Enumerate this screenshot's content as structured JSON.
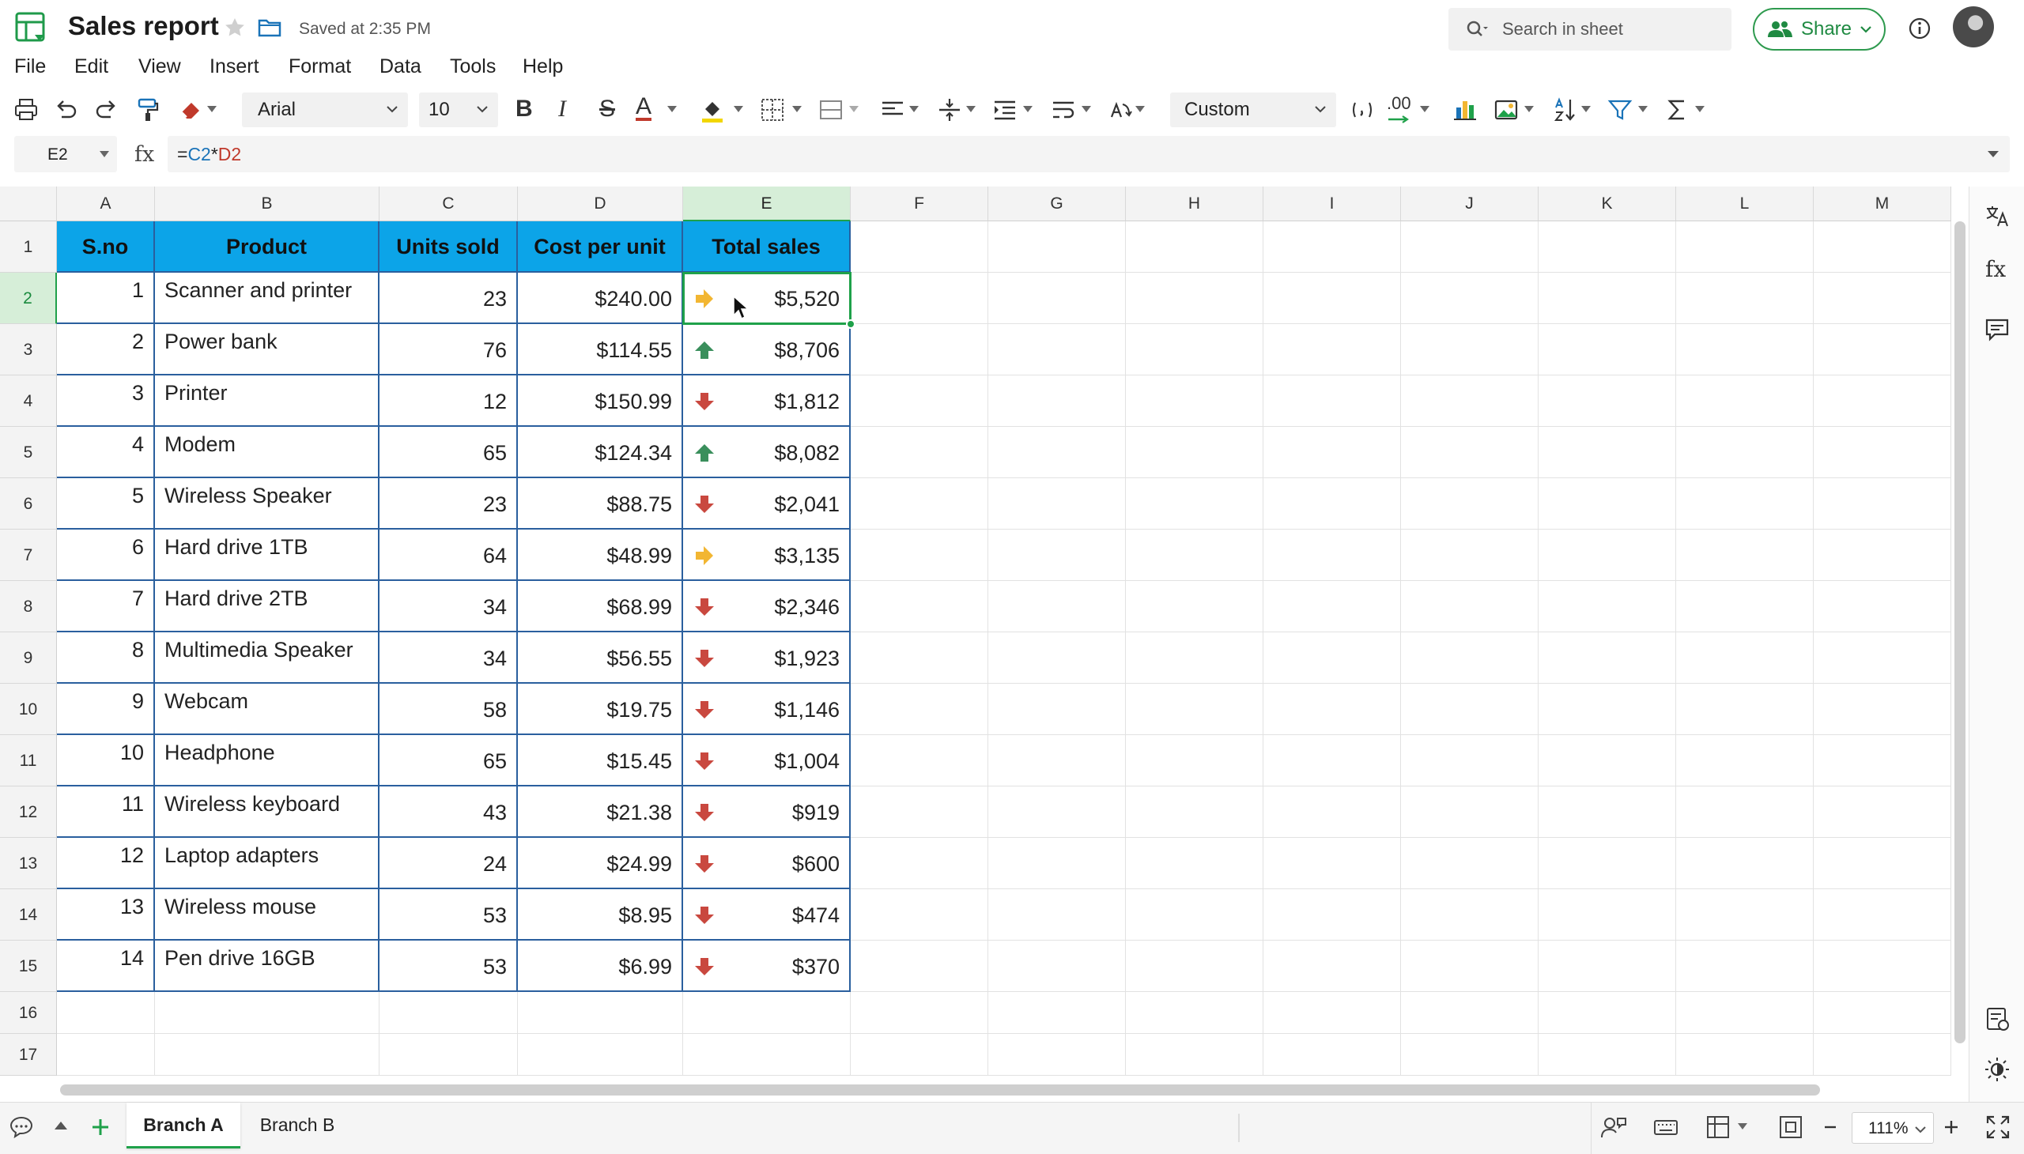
{
  "app": {
    "title": "Sales report",
    "saved_status": "Saved at 2:35 PM",
    "search_placeholder": "Search in sheet",
    "share_label": "Share"
  },
  "menu": [
    "File",
    "Edit",
    "View",
    "Insert",
    "Format",
    "Data",
    "Tools",
    "Help"
  ],
  "toolbar": {
    "font": "Arial",
    "font_size": "10",
    "number_format": "Custom",
    "bold_glyph": "B",
    "italic_glyph": "I",
    "strike_glyph": "S",
    "color_glyph": "A",
    "decimal_glyph": ".00"
  },
  "formula_bar": {
    "cell_ref": "E2",
    "fx_label": "fx",
    "formula_prefix": "=",
    "formula_ref1": "C2",
    "formula_op": "*",
    "formula_ref2": "D2"
  },
  "columns": [
    "A",
    "B",
    "C",
    "D",
    "E",
    "F",
    "G",
    "H",
    "I",
    "J",
    "K",
    "L",
    "M"
  ],
  "selected_column": "E",
  "selected_row": 2,
  "row_numbers": [
    "1",
    "2",
    "3",
    "4",
    "5",
    "6",
    "7",
    "8",
    "9",
    "10",
    "11",
    "12",
    "13",
    "14",
    "15",
    "16",
    "17"
  ],
  "table": {
    "headers": [
      "S.no",
      "Product",
      "Units sold",
      "Cost per unit",
      "Total sales"
    ],
    "rows": [
      {
        "sno": "1",
        "product": "Scanner and printer",
        "units": "23",
        "cost": "$240.00",
        "total": "$5,520",
        "trend": "right"
      },
      {
        "sno": "2",
        "product": "Power bank",
        "units": "76",
        "cost": "$114.55",
        "total": "$8,706",
        "trend": "up"
      },
      {
        "sno": "3",
        "product": "Printer",
        "units": "12",
        "cost": "$150.99",
        "total": "$1,812",
        "trend": "down"
      },
      {
        "sno": "4",
        "product": "Modem",
        "units": "65",
        "cost": "$124.34",
        "total": "$8,082",
        "trend": "up"
      },
      {
        "sno": "5",
        "product": "Wireless Speaker",
        "units": "23",
        "cost": "$88.75",
        "total": "$2,041",
        "trend": "down"
      },
      {
        "sno": "6",
        "product": "Hard drive 1TB",
        "units": "64",
        "cost": "$48.99",
        "total": "$3,135",
        "trend": "right"
      },
      {
        "sno": "7",
        "product": "Hard drive 2TB",
        "units": "34",
        "cost": "$68.99",
        "total": "$2,346",
        "trend": "down"
      },
      {
        "sno": "8",
        "product": "Multimedia Speaker",
        "units": "34",
        "cost": "$56.55",
        "total": "$1,923",
        "trend": "down"
      },
      {
        "sno": "9",
        "product": "Webcam",
        "units": "58",
        "cost": "$19.75",
        "total": "$1,146",
        "trend": "down"
      },
      {
        "sno": "10",
        "product": "Headphone",
        "units": "65",
        "cost": "$15.45",
        "total": "$1,004",
        "trend": "down"
      },
      {
        "sno": "11",
        "product": "Wireless keyboard",
        "units": "43",
        "cost": "$21.38",
        "total": "$919",
        "trend": "down"
      },
      {
        "sno": "12",
        "product": "Laptop adapters",
        "units": "24",
        "cost": "$24.99",
        "total": "$600",
        "trend": "down"
      },
      {
        "sno": "13",
        "product": "Wireless mouse",
        "units": "53",
        "cost": "$8.95",
        "total": "$474",
        "trend": "down"
      },
      {
        "sno": "14",
        "product": "Pen drive 16GB",
        "units": "53",
        "cost": "$6.99",
        "total": "$370",
        "trend": "down"
      }
    ]
  },
  "trend_colors": {
    "up": "#3a8f5c",
    "down": "#c9483f",
    "right": "#f2b632"
  },
  "colors": {
    "header_fill": "#0ca4e8",
    "accent": "#1fa14a",
    "table_border": "#2a5f9e"
  },
  "sheets": [
    {
      "label": "Branch A",
      "active": true
    },
    {
      "label": "Branch B",
      "active": false
    }
  ],
  "zoom": "111%"
}
